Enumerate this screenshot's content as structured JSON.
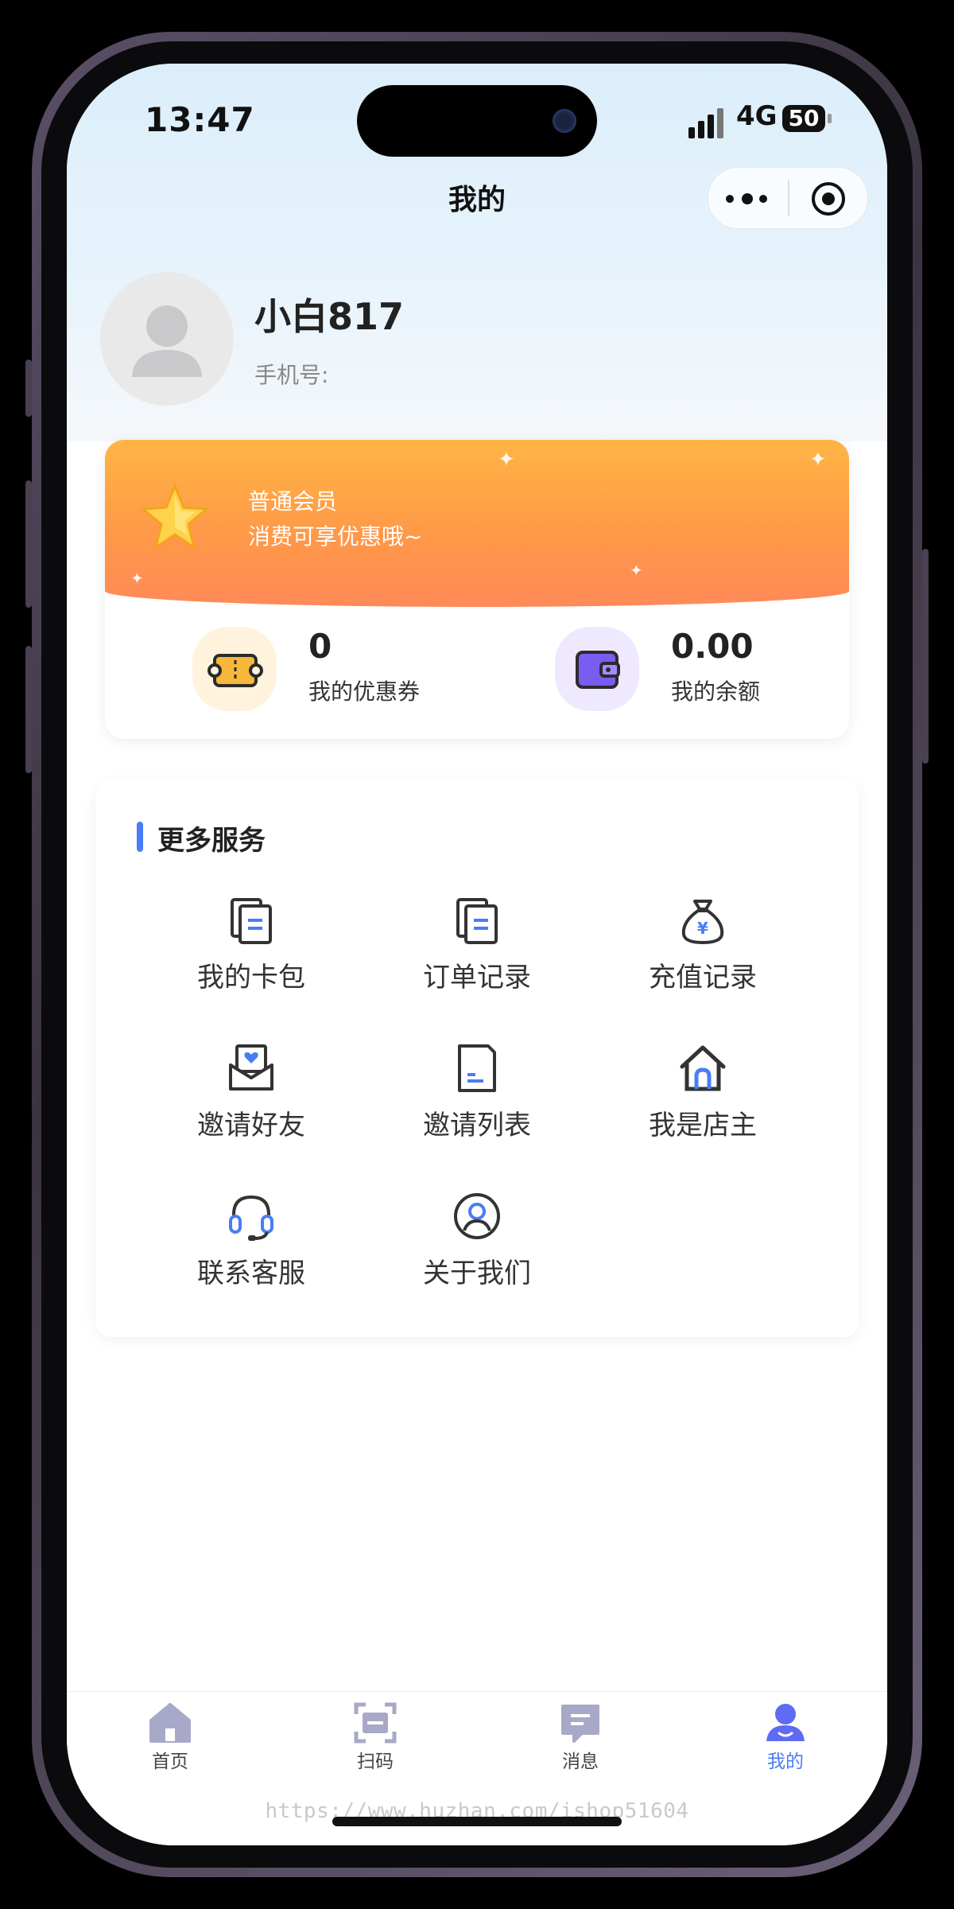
{
  "status_bar": {
    "time": "13:47",
    "network": "4G",
    "battery": "50"
  },
  "nav": {
    "title": "我的"
  },
  "capsule": {
    "more_icon": "more-dots-icon",
    "close_icon": "target-close-icon"
  },
  "profile": {
    "username": "小白817",
    "phone_label": "手机号:"
  },
  "member": {
    "level": "普通会员",
    "desc": "消费可享优惠哦~",
    "icon": "star-icon"
  },
  "stats": [
    {
      "value": "0",
      "label": "我的优惠券",
      "icon": "coupon-icon",
      "color": "#f7b73a"
    },
    {
      "value": "0.00",
      "label": "我的余额",
      "icon": "wallet-icon",
      "color": "#7b5cf0"
    }
  ],
  "services": {
    "title": "更多服务",
    "items": [
      {
        "label": "我的卡包",
        "icon": "card-bag-icon"
      },
      {
        "label": "订单记录",
        "icon": "order-record-icon"
      },
      {
        "label": "充值记录",
        "icon": "money-bag-icon"
      },
      {
        "label": "邀请好友",
        "icon": "invite-envelope-icon"
      },
      {
        "label": "邀请列表",
        "icon": "invite-list-icon"
      },
      {
        "label": "我是店主",
        "icon": "store-house-icon"
      },
      {
        "label": "联系客服",
        "icon": "headset-icon"
      },
      {
        "label": "关于我们",
        "icon": "user-circle-icon"
      }
    ]
  },
  "tabbar": {
    "tabs": [
      {
        "label": "首页",
        "icon": "home-icon",
        "active": false
      },
      {
        "label": "扫码",
        "icon": "scan-icon",
        "active": false
      },
      {
        "label": "消息",
        "icon": "message-icon",
        "active": false
      },
      {
        "label": "我的",
        "icon": "profile-icon",
        "active": true
      }
    ]
  },
  "watermark": "https://www.huzhan.com/ishop51604",
  "colors": {
    "accent": "#4a7cf6",
    "member_gradient_top": "#ffb545",
    "member_gradient_bottom": "#ff8a59",
    "tab_inactive": "#a8a8c8"
  }
}
